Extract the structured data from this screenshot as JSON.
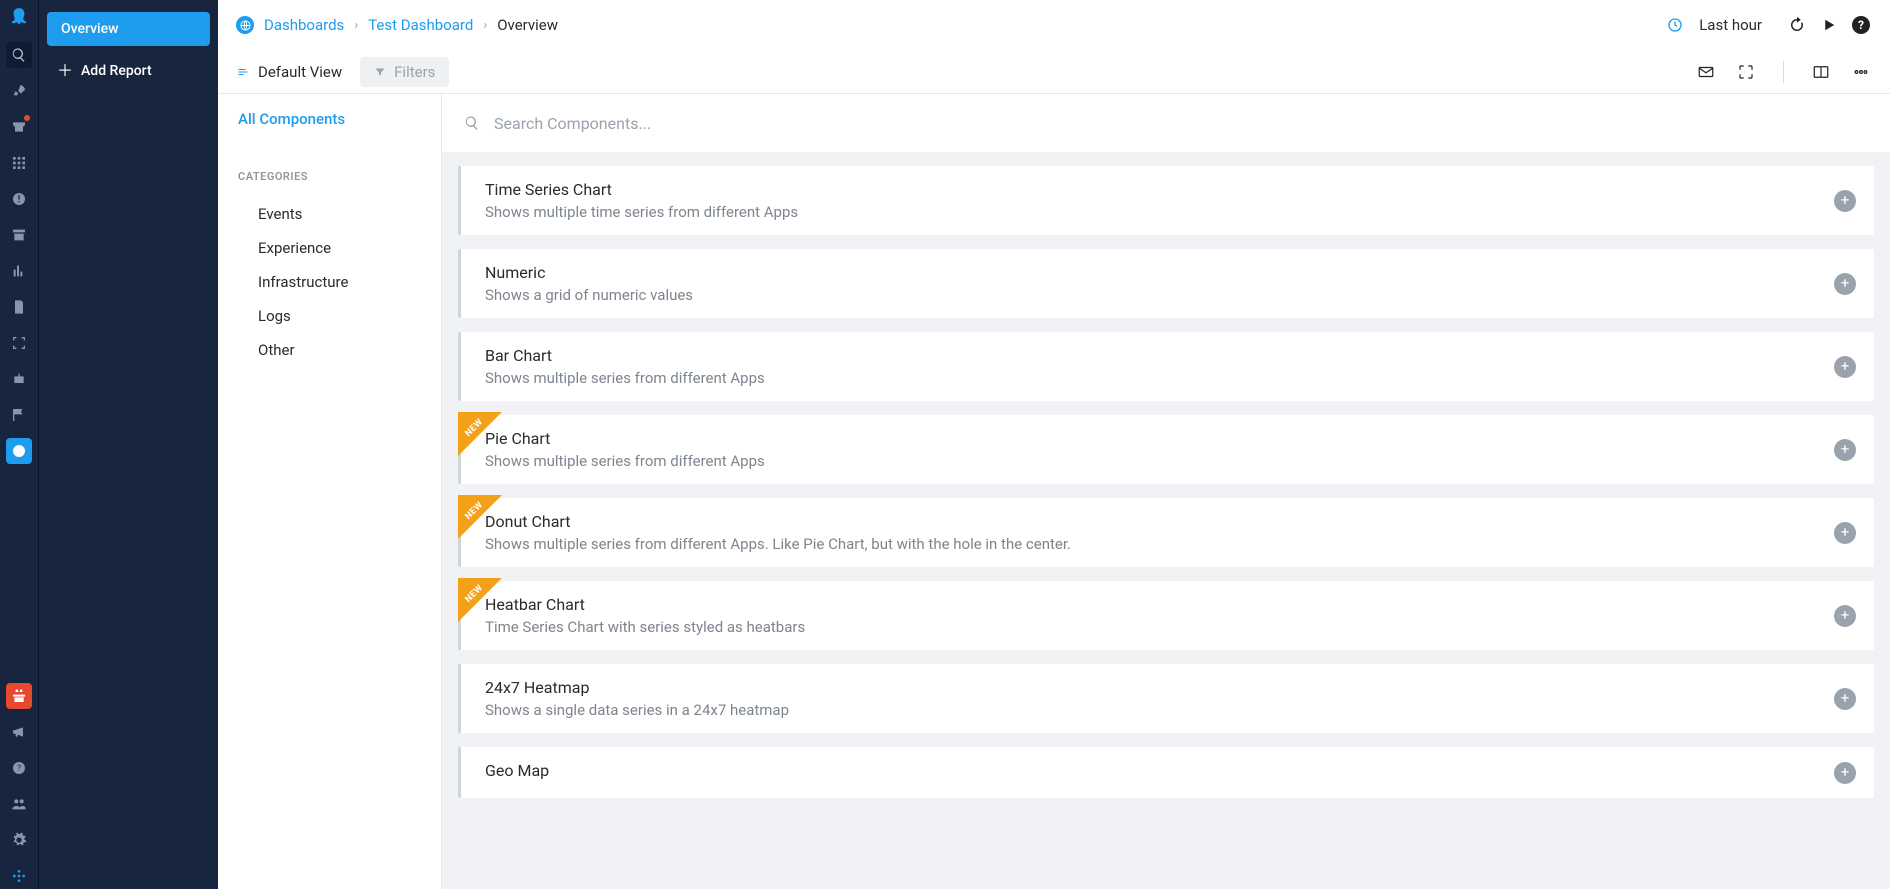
{
  "sidebar2": {
    "overview": "Overview",
    "add_report": "Add Report"
  },
  "breadcrumb": {
    "root": "Dashboards",
    "dashboard": "Test Dashboard",
    "current": "Overview"
  },
  "topbar": {
    "time_label": "Last hour"
  },
  "secondbar": {
    "view_label": "Default View",
    "filters_label": "Filters"
  },
  "catpanel": {
    "all_label": "All Components",
    "heading": "CATEGORIES",
    "items": [
      "Events",
      "Experience",
      "Infrastructure",
      "Logs",
      "Other"
    ]
  },
  "search": {
    "placeholder": "Search Components..."
  },
  "new_badge": "NEW",
  "components": [
    {
      "title": "Time Series Chart",
      "desc": "Shows multiple time series from different Apps",
      "new": false
    },
    {
      "title": "Numeric",
      "desc": "Shows a grid of numeric values",
      "new": false
    },
    {
      "title": "Bar Chart",
      "desc": "Shows multiple series from different Apps",
      "new": false
    },
    {
      "title": "Pie Chart",
      "desc": "Shows multiple series from different Apps",
      "new": true
    },
    {
      "title": "Donut Chart",
      "desc": "Shows multiple series from different Apps. Like Pie Chart, but with the hole in the center.",
      "new": true
    },
    {
      "title": "Heatbar Chart",
      "desc": "Time Series Chart with series styled as heatbars",
      "new": true
    },
    {
      "title": "24x7 Heatmap",
      "desc": "Shows a single data series in a 24x7 heatmap",
      "new": false
    },
    {
      "title": "Geo Map",
      "desc": "",
      "new": false
    }
  ]
}
